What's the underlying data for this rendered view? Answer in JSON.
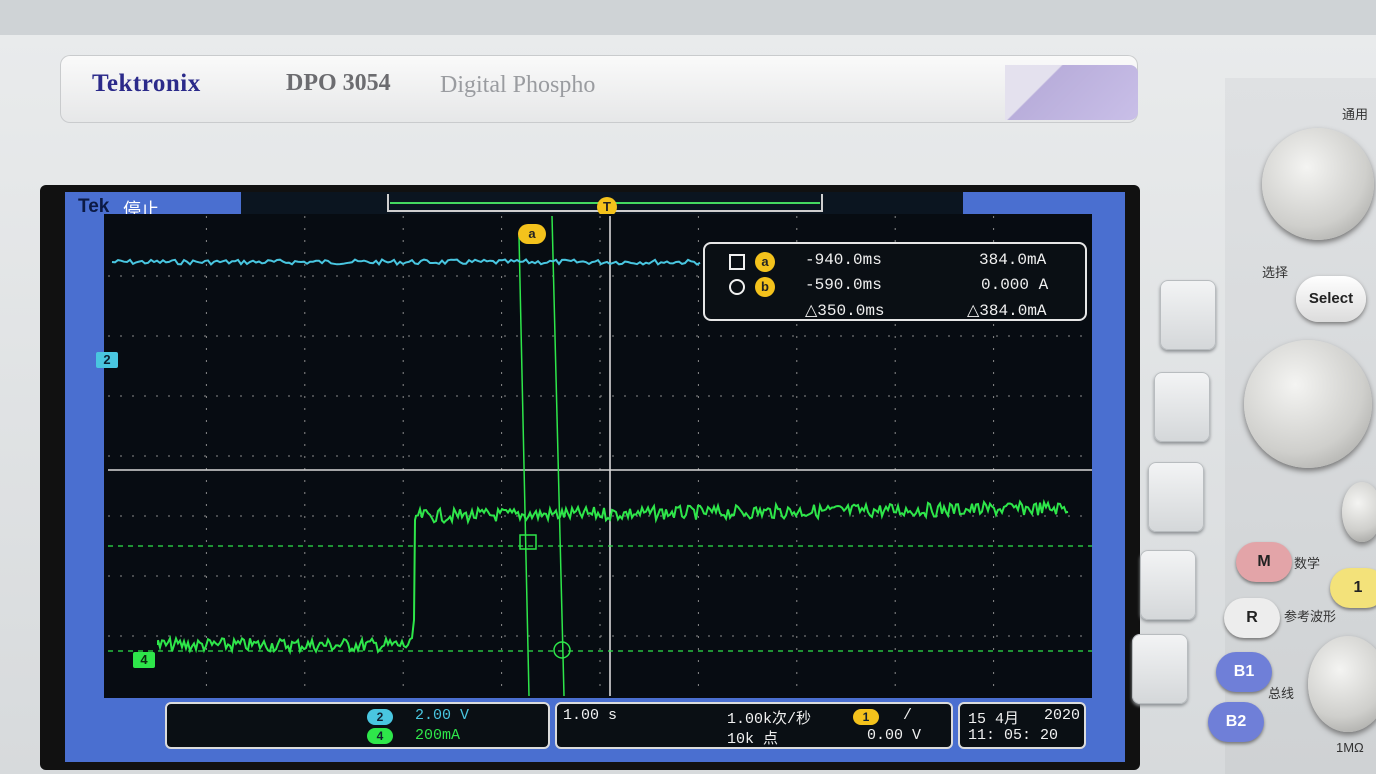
{
  "brand": {
    "logo": "Tektronix",
    "model": "DPO 3054",
    "subtitle": "Digital Phospho"
  },
  "screen": {
    "tek_label": "Tek",
    "run_state": "停止",
    "trigger_marker": "T",
    "cursor_a_label": "a",
    "channel_2_marker": "2",
    "channel_4_marker": "4",
    "colors": {
      "ch2": "#49c6e0",
      "ch4": "#2ee64a",
      "cursor": "#2ee64a",
      "grid": "#c8c8c8",
      "badge": "#f4c21c"
    }
  },
  "cursor_readout": {
    "a_symbol": "square",
    "a_badge": "a",
    "a_time": "-940.0ms",
    "a_value": "384.0mA",
    "b_symbol": "circle",
    "b_badge": "b",
    "b_time": "-590.0ms",
    "b_value": "0.000 A",
    "delta_time": "△350.0ms",
    "delta_value": "△384.0mA"
  },
  "status_bar": {
    "ch2_chip": "2",
    "ch2_scale": "2.00 V",
    "ch4_chip": "4",
    "ch4_scale": "200mA",
    "timebase": "1.00 s",
    "sample_rate": "1.00k次/秒",
    "record_length": "10k 点",
    "trigger_chip": "1",
    "trigger_slope": "/",
    "trigger_level": "0.00 V",
    "date_day_month": "15 4月",
    "date_year": "2020",
    "time": "11: 05: 20"
  },
  "front_panel": {
    "general_label": "通用",
    "select_cn_label": "选择",
    "select_button": "Select",
    "math_button": "M",
    "math_label": "数学",
    "ref_button": "R",
    "ref_label": "参考波形",
    "b1_button": "B1",
    "b2_button": "B2",
    "bus_label": "总线",
    "ch1_button": "1",
    "impedance_label": "1MΩ"
  }
}
